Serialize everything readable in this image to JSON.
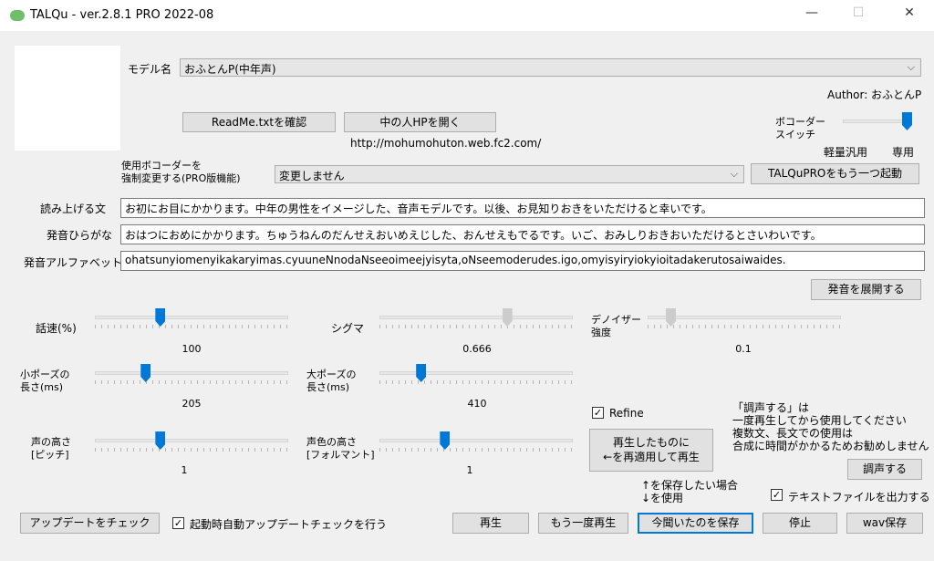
{
  "window": {
    "title": "TALQu - ver.2.8.1 PRO 2022-08",
    "minimize": "—",
    "maximize": "☐",
    "close": "✕"
  },
  "model": {
    "label": "モデル名",
    "selected": "おふとんP(中年声)",
    "author": "Author: おふとんP",
    "readme_button": "ReadMe.txtを確認",
    "hp_button": "中の人HPを開く",
    "url": "http://mohumohuton.web.fc2.com/"
  },
  "vocoder": {
    "label_line1": "ボコーダー",
    "label_line2": "スイッチ",
    "left_label": "軽量汎用",
    "right_label": "専用",
    "value_fraction": 1.0
  },
  "force_vocoder": {
    "label_line1": "使用ボコーダーを",
    "label_line2": "強制変更する(PRO版機能)",
    "selected": "変更しません",
    "launch_button": "TALQuPROをもう一つ起動"
  },
  "texts": {
    "read_label": "読み上げる文",
    "read_value": "お初にお目にかかります。中年の男性をイメージした、音声モデルです。以後、お見知りおきをいただけると幸いです。",
    "hira_label": "発音ひらがな",
    "hira_value": "おはつにおめにかかります。ちゅうねんのだんせえおいめえじした、おんせえもでるです。いご、おみしりおきおいただけるとさいわいです。",
    "alpha_label": "発音アルファベット",
    "alpha_value": "ohatsunyiomenyikakaryimas.cyuuneNnodaNseeoimeejyisyta,oNseemoderudes.igo,omyisyiryiokyioitadakerutosaiwaides.",
    "expand_button": "発音を展開する"
  },
  "sliders": {
    "speed": {
      "label": "話速(%)",
      "value": "100",
      "fraction": 0.33
    },
    "sigma": {
      "label": "シグマ",
      "value": "0.666",
      "fraction": 0.67
    },
    "denoise": {
      "label_line1": "デノイザー",
      "label_line2": "強度",
      "value": "0.1",
      "fraction": 0.1
    },
    "small_pause": {
      "label_line1": "小ポーズの",
      "label_line2": "長さ(ms)",
      "value": "205",
      "fraction": 0.25
    },
    "big_pause": {
      "label_line1": "大ポーズの",
      "label_line2": "長さ(ms)",
      "value": "410",
      "fraction": 0.2
    },
    "pitch": {
      "label_line1": "声の高さ",
      "label_line2": "[ピッチ]",
      "value": "1",
      "fraction": 0.33
    },
    "formant": {
      "label_line1": "声色の高さ",
      "label_line2": "[フォルマント]",
      "value": "1",
      "fraction": 0.33
    }
  },
  "refine": {
    "label": "Refine",
    "checked": "✓"
  },
  "reapply_button_line1": "再生したものに",
  "reapply_button_line2": "←を再適用して再生",
  "tune_note": {
    "line1": "「調声する」は",
    "line2": "一度再生してから使用してください",
    "line3": "複数文、長文での使用は",
    "line4": "合成に時間がかかるためお勧めしません"
  },
  "tune_button": "調声する",
  "save_note": {
    "line1": "↑を保存したい場合",
    "line2": "↓を使用"
  },
  "text_output": {
    "label": "テキストファイルを出力する",
    "checked": "✓"
  },
  "footer": {
    "update_button": "アップデートをチェック",
    "auto_update_label": "起動時自動アップデートチェックを行う",
    "auto_update_checked": "✓",
    "play_button": "再生",
    "replay_button": "もう一度再生",
    "save_heard_button": "今聞いたのを保存",
    "stop_button": "停止",
    "wav_button": "wav保存"
  }
}
